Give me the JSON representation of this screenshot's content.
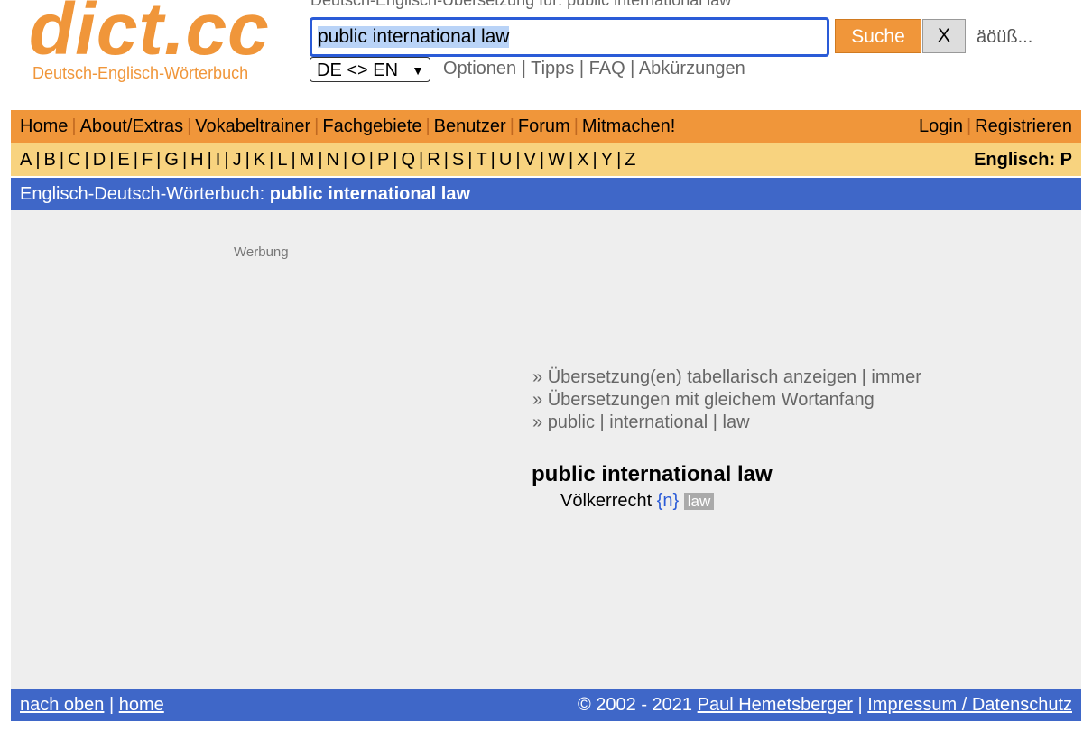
{
  "logo": {
    "text": "dict.cc",
    "subtitle": "Deutsch-Englisch-Wörterbuch"
  },
  "header": {
    "title": "Deutsch-Englisch-Übersetzung für: public international law"
  },
  "search": {
    "value": "public international law",
    "button": "Suche",
    "clear": "X",
    "special_chars": "äöüß..."
  },
  "lang_select": "DE <> EN",
  "options": [
    "Optionen",
    "Tipps",
    "FAQ",
    "Abkürzungen"
  ],
  "nav": {
    "left": [
      "Home",
      "About/Extras",
      "Vokabeltrainer",
      "Fachgebiete",
      "Benutzer",
      "Forum",
      "Mitmachen!"
    ],
    "right": [
      "Login",
      "Registrieren"
    ]
  },
  "alphabet": [
    "A",
    "B",
    "C",
    "D",
    "E",
    "F",
    "G",
    "H",
    "I",
    "J",
    "K",
    "L",
    "M",
    "N",
    "O",
    "P",
    "Q",
    "R",
    "S",
    "T",
    "U",
    "V",
    "W",
    "X",
    "Y",
    "Z"
  ],
  "alpha_right": "Englisch: P",
  "breadcrumb": {
    "prefix": "Englisch-Deutsch-Wörterbuch:",
    "term": "public international law"
  },
  "ad_label": "Werbung",
  "links": {
    "l1a": "Übersetzung(en) tabellarisch anzeigen",
    "l1b": "immer",
    "l2": "Übersetzungen mit gleichem Wortanfang",
    "words": [
      "public",
      "international",
      "law"
    ]
  },
  "result": {
    "term": "public international law",
    "translation": "Völkerrecht",
    "gender": "{n}",
    "subject": "law"
  },
  "footer": {
    "top": "nach oben",
    "home": "home",
    "copyright": "© 2002 - 2021",
    "author": "Paul Hemetsberger",
    "imprint": "Impressum / Datenschutz"
  }
}
